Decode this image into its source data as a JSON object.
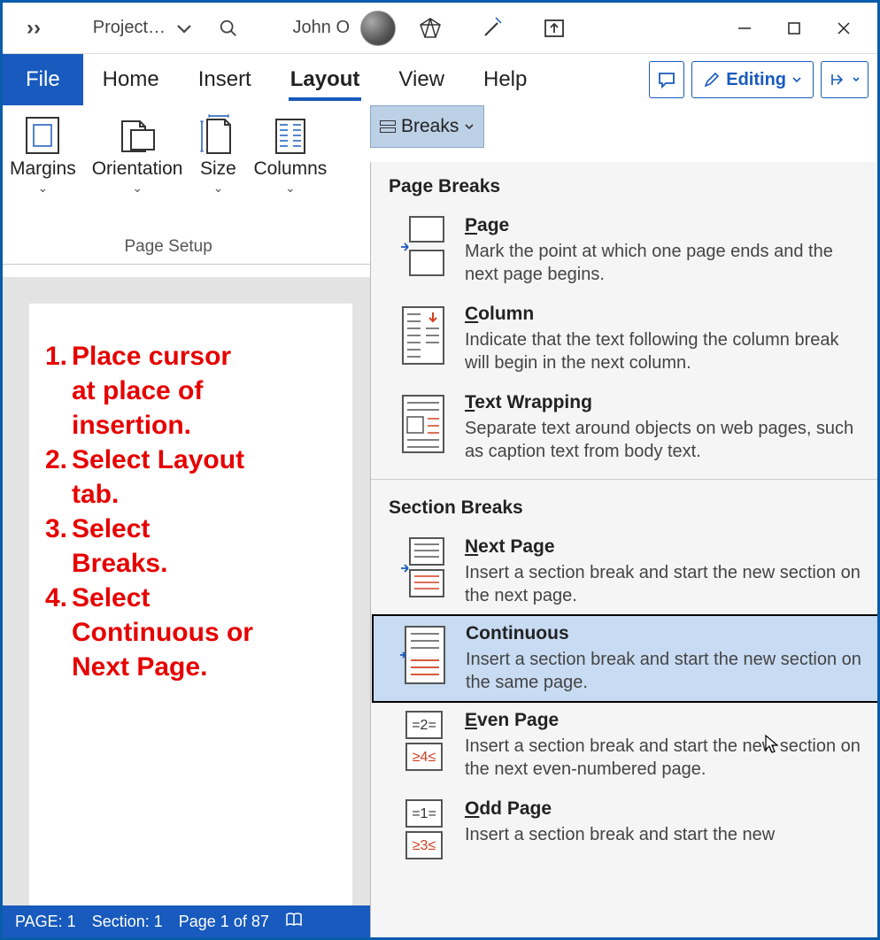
{
  "titlebar": {
    "doc_name": "Project…",
    "user_name": "John O"
  },
  "tabs": {
    "file": "File",
    "home": "Home",
    "insert": "Insert",
    "layout": "Layout",
    "view": "View",
    "help": "Help",
    "editing": "Editing"
  },
  "ribbon": {
    "margins": "Margins",
    "orientation": "Orientation",
    "size": "Size",
    "columns": "Columns",
    "group_label": "Page Setup",
    "breaks_label": "Breaks"
  },
  "dropdown": {
    "section1_header": "Page Breaks",
    "section2_header": "Section Breaks",
    "items": {
      "page": {
        "title_u": "P",
        "title_rest": "age",
        "desc": "Mark the point at which one page ends and the next page begins."
      },
      "column": {
        "title_u": "C",
        "title_rest": "olumn",
        "desc": "Indicate that the text following the column break will begin in the next column."
      },
      "textwrap": {
        "title_u": "T",
        "title_rest": "ext Wrapping",
        "desc": "Separate text around objects on web pages, such as caption text from body text."
      },
      "nextpage": {
        "title_u": "N",
        "title_rest": "ext Page",
        "desc": "Insert a section break and start the new section on the next page."
      },
      "continuous": {
        "title_u": "",
        "title_rest": "Continuous",
        "desc": "Insert a section break and start the new section on the same page."
      },
      "evenpage": {
        "title_u": "E",
        "title_rest": "ven Page",
        "desc": "Insert a section break and start the new section on the next even-numbered page."
      },
      "oddpage": {
        "title_u": "O",
        "title_rest": "dd Page",
        "desc": "Insert a section break and start the new"
      }
    }
  },
  "instructions": {
    "l1a": "1.",
    "l1b": "Place cursor",
    "l2": "at place of",
    "l3": "insertion.",
    "l4a": "2.",
    "l4b": "Select Layout",
    "l5": "tab.",
    "l6a": "3.",
    "l6b": "Select",
    "l7": "Breaks.",
    "l8a": "4.",
    "l8b": "Select",
    "l9": "Continuous or",
    "l10": "Next Page."
  },
  "statusbar": {
    "page": "PAGE: 1",
    "section": "Section: 1",
    "pages": "Page 1 of 87"
  }
}
